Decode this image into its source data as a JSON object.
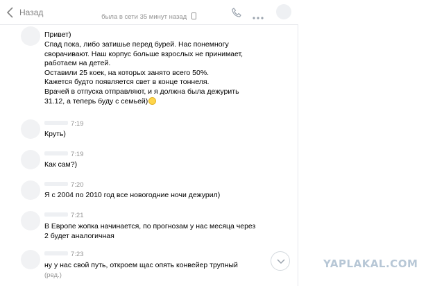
{
  "header": {
    "back_label": "Назад",
    "status": "была в сети 35 минут назад"
  },
  "messages": [
    {
      "time": "",
      "lines": [
        "Привет)",
        "Спад пока, либо затишье перед бурей. Нас понемногу",
        "сворачивают. Наш корпус больше взрослых не принимает,",
        "работаем на детей.",
        "Оставили 25 коек, на которых занято всего 50%.",
        "Кажется будто появляется свет в конце тоннеля.",
        "Врачей в отпуска отправляют, и я должна была дежурить",
        "31.12, а теперь буду с семьей)"
      ]
    },
    {
      "time": "7:19",
      "lines": [
        "Круть)"
      ]
    },
    {
      "time": "7:19",
      "lines": [
        "Как сам?)"
      ]
    },
    {
      "time": "7:20",
      "lines": [
        "Я с 2004 по 2010 год все новогодние ночи дежурил)"
      ]
    },
    {
      "time": "7:21",
      "lines": [
        "В Европе жопка начинается, по прогнозам у нас месяца через",
        "2 будет аналогичная"
      ]
    },
    {
      "time": "7:23",
      "lines": [
        "ну у нас свой путь, откроем щас опять конвейер трупный"
      ],
      "edited": "(ред.)"
    }
  ],
  "watermark": "YAPLAKAL.COM",
  "colors": {
    "accent": "#828282",
    "meta": "#939393",
    "border": "#e7e8ec",
    "watermark": "#b7c7d6"
  },
  "icons": {
    "back": "chevron-left-icon",
    "call": "phone-icon",
    "more": "more-dots-icon",
    "scroll": "chevron-down-icon",
    "status": "mobile-phone-icon",
    "emoji": "smiling-face-emoji-icon"
  }
}
